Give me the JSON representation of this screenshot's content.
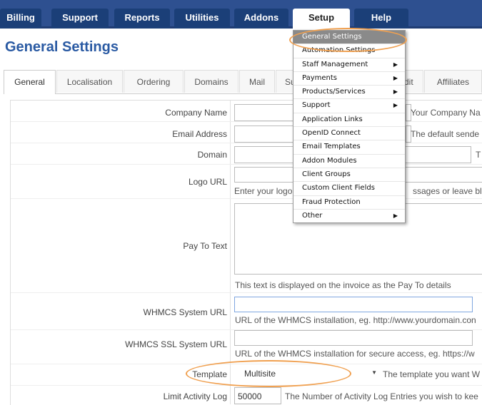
{
  "topnav": {
    "tabs": [
      "Billing",
      "Support",
      "Reports",
      "Utilities",
      "Addons",
      "Setup",
      "Help"
    ],
    "active": "Setup"
  },
  "page_title": "General Settings",
  "subtabs": [
    "General",
    "Localisation",
    "Ordering",
    "Domains",
    "Mail",
    "Su",
    "dit",
    "Affiliates"
  ],
  "setup_menu": {
    "items": [
      {
        "label": "General Settings",
        "submenu": false
      },
      {
        "label": "Automation Settings",
        "submenu": false
      },
      {
        "label": "Staff Management",
        "submenu": true
      },
      {
        "label": "Payments",
        "submenu": true
      },
      {
        "label": "Products/Services",
        "submenu": true
      },
      {
        "label": "Support",
        "submenu": true
      },
      {
        "label": "Application Links",
        "submenu": false
      },
      {
        "label": "OpenID Connect",
        "submenu": false
      },
      {
        "label": "Email Templates",
        "submenu": false
      },
      {
        "label": "Addon Modules",
        "submenu": false
      },
      {
        "label": "Client Groups",
        "submenu": false
      },
      {
        "label": "Custom Client Fields",
        "submenu": false
      },
      {
        "label": "Fraud Protection",
        "submenu": false
      },
      {
        "label": "Other",
        "submenu": true
      }
    ]
  },
  "form": {
    "company_name": {
      "label": "Company Name",
      "hint": "Your Company Na"
    },
    "email_address": {
      "label": "Email Address",
      "hint": "The default sende"
    },
    "domain": {
      "label": "Domain",
      "hint": "T"
    },
    "logo_url": {
      "label": "Logo URL",
      "hint_left": "Enter your logo",
      "hint_right": "ssages or leave blar"
    },
    "pay_to_text": {
      "label": "Pay To Text",
      "hint": "This text is displayed on the invoice as the Pay To details"
    },
    "system_url": {
      "label": "WHMCS System URL",
      "hint": "URL of the WHMCS installation, eg. http://www.yourdomain.con"
    },
    "ssl_url": {
      "label": "WHMCS SSL System URL",
      "hint": "URL of the WHMCS installation for secure access, eg. https://w"
    },
    "template": {
      "label": "Template",
      "value": "Multisite",
      "hint": "The template you want W"
    },
    "activity_log": {
      "label": "Limit Activity Log",
      "value": "50000",
      "hint": "The Number of Activity Log Entries you wish to kee"
    }
  },
  "colors": {
    "nav": "#2e5090",
    "title": "#2a5aa3",
    "highlight_oval": "#f0a050"
  }
}
